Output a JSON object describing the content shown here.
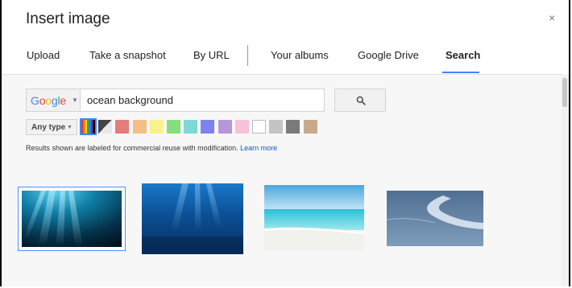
{
  "dialog": {
    "title": "Insert image",
    "close_glyph": "×"
  },
  "tabs": [
    {
      "label": "Upload"
    },
    {
      "label": "Take a snapshot"
    },
    {
      "label": "By URL"
    },
    {
      "label": "Your albums"
    },
    {
      "label": "Google Drive"
    },
    {
      "label": "Search",
      "active": true
    }
  ],
  "search": {
    "engine_label": "Google",
    "query": "ocean background",
    "button_icon": "search-icon"
  },
  "filters": {
    "type_label": "Any type",
    "colors": [
      {
        "name": "full-color",
        "value": "rainbow",
        "selected": true
      },
      {
        "name": "black-and-white",
        "value": "gradient-bw"
      },
      {
        "name": "red",
        "value": "#e57c7c"
      },
      {
        "name": "orange",
        "value": "#f4bf84"
      },
      {
        "name": "yellow",
        "value": "#f9f28c"
      },
      {
        "name": "green",
        "value": "#86df7f"
      },
      {
        "name": "teal",
        "value": "#7fd8d8"
      },
      {
        "name": "blue",
        "value": "#7e82ec"
      },
      {
        "name": "purple",
        "value": "#b796d8"
      },
      {
        "name": "pink",
        "value": "#f7c2d9"
      },
      {
        "name": "white",
        "value": "#ffffff"
      },
      {
        "name": "gray",
        "value": "#c4c4c4"
      },
      {
        "name": "black",
        "value": "#7a7a7a"
      },
      {
        "name": "brown",
        "value": "#c9a98b"
      }
    ]
  },
  "notice": {
    "text": "Results shown are labeled for commercial reuse with modification.",
    "link": "Learn more"
  },
  "results": [
    {
      "name": "underwater-light-rays",
      "selected": true
    },
    {
      "name": "deep-blue-sea"
    },
    {
      "name": "tropical-beach"
    },
    {
      "name": "ocean-surface-aerial"
    }
  ],
  "colors": {
    "accent": "#4285f4",
    "link": "#1155cc",
    "content_bg": "#f7f7f7"
  }
}
